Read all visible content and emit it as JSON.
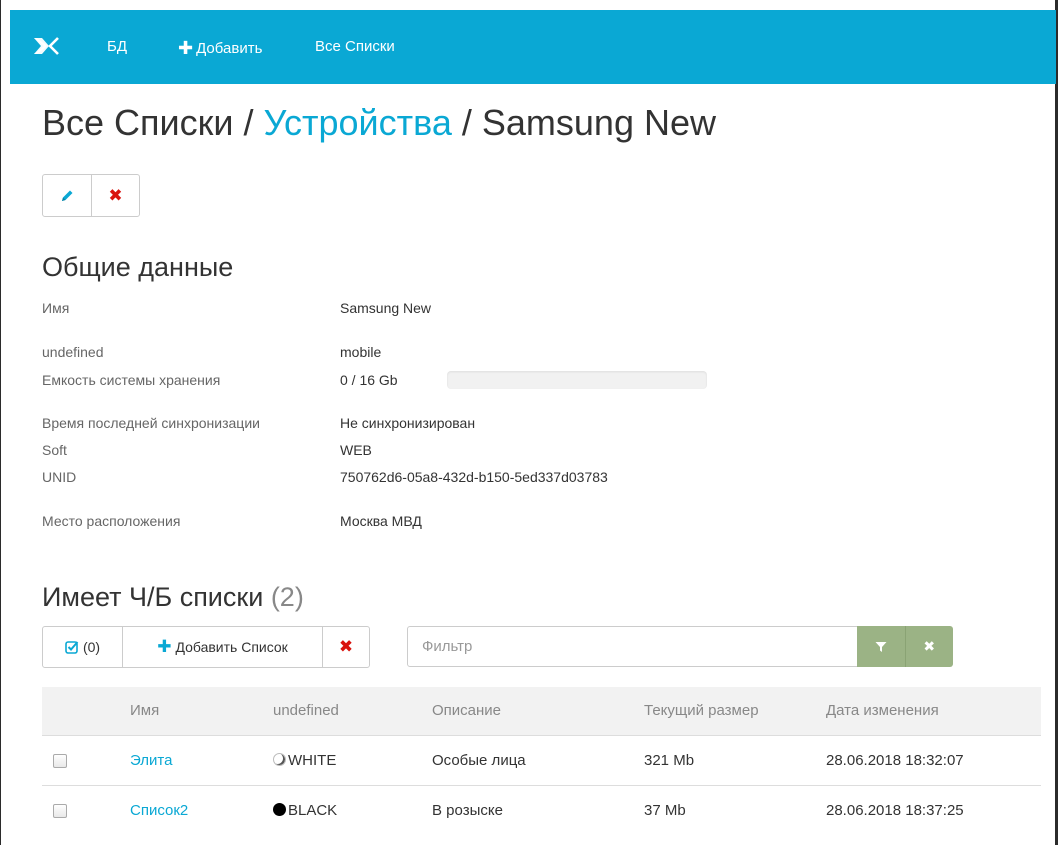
{
  "navbar": {
    "items": [
      {
        "label": "БД"
      },
      {
        "label": "Добавить"
      },
      {
        "label": "Все Списки"
      }
    ],
    "plus_icon": "plus-icon",
    "logo_icon": "logo-icon"
  },
  "breadcrumb": {
    "root": "Все Списки",
    "separator": " / ",
    "parent": "Устройства",
    "current": "Samsung New"
  },
  "actions": {
    "edit_icon": "pencil-icon",
    "delete_icon": "close-icon"
  },
  "general": {
    "title": "Общие данные",
    "fields": {
      "name": {
        "label": "Имя",
        "value": "Samsung New"
      },
      "type": {
        "label": "undefined",
        "value": "mobile"
      },
      "storage": {
        "label": "Емкость системы хранения",
        "value": "0 / 16 Gb",
        "used_fraction": 0
      },
      "last_sync": {
        "label": "Время последней синхронизации",
        "value": "Не синхронизирован"
      },
      "soft": {
        "label": "Soft",
        "value": "WEB"
      },
      "unid": {
        "label": "UNID",
        "value": "750762d6-05a8-432d-b150-5ed337d03783"
      },
      "location": {
        "label": "Место расположения",
        "value": "Москва МВД"
      }
    }
  },
  "lists_section": {
    "title": "Имеет Ч/Б списки",
    "count": "(2)",
    "toolbar": {
      "selected_count": "(0)",
      "add_label": "Добавить Список"
    },
    "filter": {
      "placeholder": "Фильтр",
      "value": ""
    }
  },
  "table": {
    "columns": [
      "Имя",
      "undefined",
      "Описание",
      "Текущий размер",
      "Дата изменения"
    ],
    "rows": [
      {
        "name": "Элита",
        "color": "WHITE",
        "description": "Особые лица",
        "size": "321 Mb",
        "modified": "28.06.2018 18:32:07"
      },
      {
        "name": "Список2",
        "color": "BLACK",
        "description": "В розыске",
        "size": "37 Mb",
        "modified": "28.06.2018 18:37:25"
      }
    ]
  },
  "colors": {
    "accent": "#0aa8d4",
    "danger": "#d9120c",
    "filter_button": "#9bb385"
  }
}
